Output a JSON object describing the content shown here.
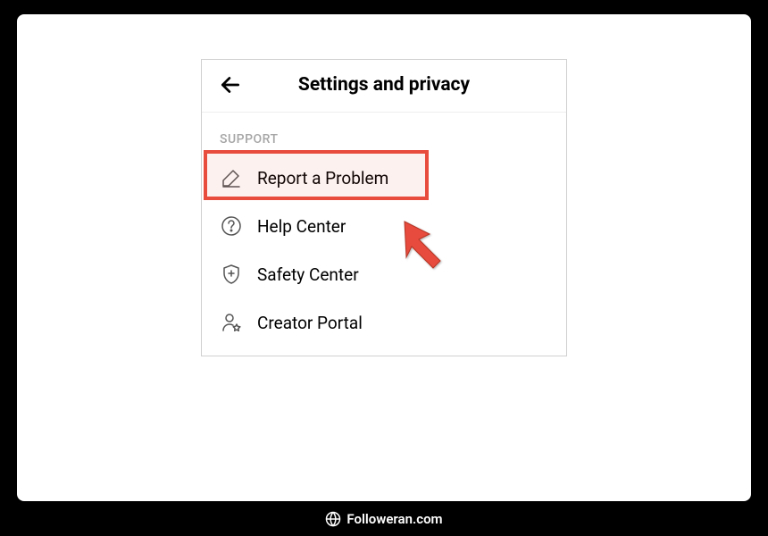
{
  "header": {
    "title": "Settings and privacy"
  },
  "section": {
    "label": "SUPPORT",
    "items": [
      {
        "label": "Report a Problem",
        "icon": "pencil"
      },
      {
        "label": "Help Center",
        "icon": "question"
      },
      {
        "label": "Safety Center",
        "icon": "shield"
      },
      {
        "label": "Creator Portal",
        "icon": "person-star"
      }
    ]
  },
  "annotation": {
    "highlight_color": "#e74c3c",
    "arrow_color": "#e74c3c"
  },
  "watermark": "Followeran.com"
}
